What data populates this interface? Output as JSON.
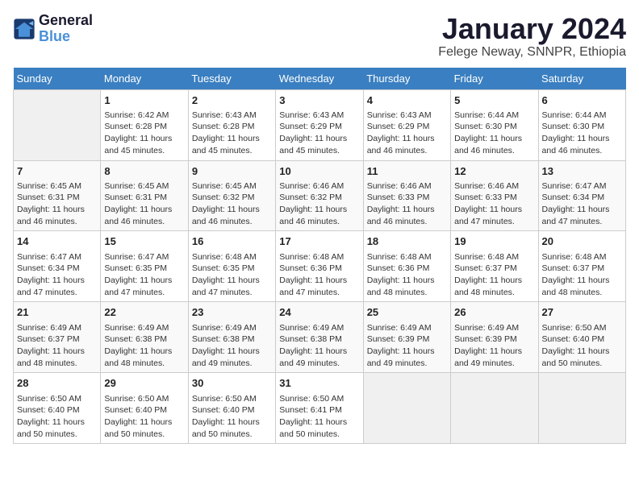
{
  "logo": {
    "line1": "General",
    "line2": "Blue"
  },
  "title": "January 2024",
  "subtitle": "Felege Neway, SNNPR, Ethiopia",
  "days_of_week": [
    "Sunday",
    "Monday",
    "Tuesday",
    "Wednesday",
    "Thursday",
    "Friday",
    "Saturday"
  ],
  "weeks": [
    [
      {
        "num": "",
        "detail": ""
      },
      {
        "num": "1",
        "detail": "Sunrise: 6:42 AM\nSunset: 6:28 PM\nDaylight: 11 hours\nand 45 minutes."
      },
      {
        "num": "2",
        "detail": "Sunrise: 6:43 AM\nSunset: 6:28 PM\nDaylight: 11 hours\nand 45 minutes."
      },
      {
        "num": "3",
        "detail": "Sunrise: 6:43 AM\nSunset: 6:29 PM\nDaylight: 11 hours\nand 45 minutes."
      },
      {
        "num": "4",
        "detail": "Sunrise: 6:43 AM\nSunset: 6:29 PM\nDaylight: 11 hours\nand 46 minutes."
      },
      {
        "num": "5",
        "detail": "Sunrise: 6:44 AM\nSunset: 6:30 PM\nDaylight: 11 hours\nand 46 minutes."
      },
      {
        "num": "6",
        "detail": "Sunrise: 6:44 AM\nSunset: 6:30 PM\nDaylight: 11 hours\nand 46 minutes."
      }
    ],
    [
      {
        "num": "7",
        "detail": "Sunrise: 6:45 AM\nSunset: 6:31 PM\nDaylight: 11 hours\nand 46 minutes."
      },
      {
        "num": "8",
        "detail": "Sunrise: 6:45 AM\nSunset: 6:31 PM\nDaylight: 11 hours\nand 46 minutes."
      },
      {
        "num": "9",
        "detail": "Sunrise: 6:45 AM\nSunset: 6:32 PM\nDaylight: 11 hours\nand 46 minutes."
      },
      {
        "num": "10",
        "detail": "Sunrise: 6:46 AM\nSunset: 6:32 PM\nDaylight: 11 hours\nand 46 minutes."
      },
      {
        "num": "11",
        "detail": "Sunrise: 6:46 AM\nSunset: 6:33 PM\nDaylight: 11 hours\nand 46 minutes."
      },
      {
        "num": "12",
        "detail": "Sunrise: 6:46 AM\nSunset: 6:33 PM\nDaylight: 11 hours\nand 47 minutes."
      },
      {
        "num": "13",
        "detail": "Sunrise: 6:47 AM\nSunset: 6:34 PM\nDaylight: 11 hours\nand 47 minutes."
      }
    ],
    [
      {
        "num": "14",
        "detail": "Sunrise: 6:47 AM\nSunset: 6:34 PM\nDaylight: 11 hours\nand 47 minutes."
      },
      {
        "num": "15",
        "detail": "Sunrise: 6:47 AM\nSunset: 6:35 PM\nDaylight: 11 hours\nand 47 minutes."
      },
      {
        "num": "16",
        "detail": "Sunrise: 6:48 AM\nSunset: 6:35 PM\nDaylight: 11 hours\nand 47 minutes."
      },
      {
        "num": "17",
        "detail": "Sunrise: 6:48 AM\nSunset: 6:36 PM\nDaylight: 11 hours\nand 47 minutes."
      },
      {
        "num": "18",
        "detail": "Sunrise: 6:48 AM\nSunset: 6:36 PM\nDaylight: 11 hours\nand 48 minutes."
      },
      {
        "num": "19",
        "detail": "Sunrise: 6:48 AM\nSunset: 6:37 PM\nDaylight: 11 hours\nand 48 minutes."
      },
      {
        "num": "20",
        "detail": "Sunrise: 6:48 AM\nSunset: 6:37 PM\nDaylight: 11 hours\nand 48 minutes."
      }
    ],
    [
      {
        "num": "21",
        "detail": "Sunrise: 6:49 AM\nSunset: 6:37 PM\nDaylight: 11 hours\nand 48 minutes."
      },
      {
        "num": "22",
        "detail": "Sunrise: 6:49 AM\nSunset: 6:38 PM\nDaylight: 11 hours\nand 48 minutes."
      },
      {
        "num": "23",
        "detail": "Sunrise: 6:49 AM\nSunset: 6:38 PM\nDaylight: 11 hours\nand 49 minutes."
      },
      {
        "num": "24",
        "detail": "Sunrise: 6:49 AM\nSunset: 6:38 PM\nDaylight: 11 hours\nand 49 minutes."
      },
      {
        "num": "25",
        "detail": "Sunrise: 6:49 AM\nSunset: 6:39 PM\nDaylight: 11 hours\nand 49 minutes."
      },
      {
        "num": "26",
        "detail": "Sunrise: 6:49 AM\nSunset: 6:39 PM\nDaylight: 11 hours\nand 49 minutes."
      },
      {
        "num": "27",
        "detail": "Sunrise: 6:50 AM\nSunset: 6:40 PM\nDaylight: 11 hours\nand 50 minutes."
      }
    ],
    [
      {
        "num": "28",
        "detail": "Sunrise: 6:50 AM\nSunset: 6:40 PM\nDaylight: 11 hours\nand 50 minutes."
      },
      {
        "num": "29",
        "detail": "Sunrise: 6:50 AM\nSunset: 6:40 PM\nDaylight: 11 hours\nand 50 minutes."
      },
      {
        "num": "30",
        "detail": "Sunrise: 6:50 AM\nSunset: 6:40 PM\nDaylight: 11 hours\nand 50 minutes."
      },
      {
        "num": "31",
        "detail": "Sunrise: 6:50 AM\nSunset: 6:41 PM\nDaylight: 11 hours\nand 50 minutes."
      },
      {
        "num": "",
        "detail": ""
      },
      {
        "num": "",
        "detail": ""
      },
      {
        "num": "",
        "detail": ""
      }
    ]
  ]
}
